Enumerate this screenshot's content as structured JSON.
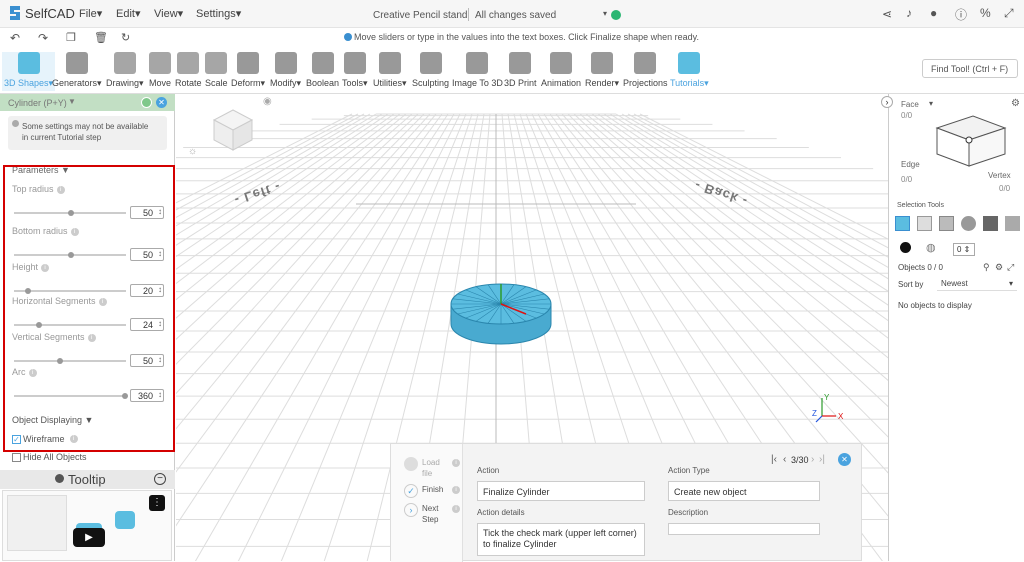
{
  "app": {
    "logo_text": "SelfCAD",
    "menus": [
      "File",
      "Edit",
      "View",
      "Settings"
    ],
    "doc_title": "Creative Pencil stand",
    "save_status": "All changes saved",
    "info_message": "Move sliders or type in the values into the text boxes. Click Finalize shape when ready."
  },
  "toolbar": {
    "tools": [
      "3D Shapes",
      "Generators",
      "Drawing",
      "Move",
      "Rotate",
      "Scale",
      "Deform",
      "Modify",
      "Boolean",
      "Tools",
      "Utilities",
      "Sculpting",
      "Image To 3D",
      "3D Print",
      "Animation",
      "Render",
      "Projections",
      "Tutorials"
    ],
    "search_label": "Find Tool! (Ctrl + F)"
  },
  "panel": {
    "title": "Cylinder (P+Y)",
    "warning": "Some settings may not be available in current Tutorial step",
    "parameters_label": "Parameters",
    "params": [
      {
        "label": "Top radius",
        "value": "50",
        "fraction": 0.5
      },
      {
        "label": "Bottom radius",
        "value": "50",
        "fraction": 0.5
      },
      {
        "label": "Height",
        "value": "20",
        "fraction": 0.1
      },
      {
        "label": "Horizontal Segments",
        "value": "24",
        "fraction": 0.2
      },
      {
        "label": "Vertical Segments",
        "value": "50",
        "fraction": 0.4
      },
      {
        "label": "Arc",
        "value": "360",
        "fraction": 1.0
      }
    ],
    "object_displaying": "Object Displaying",
    "wireframe": "Wireframe",
    "hide_all": "Hide All Objects",
    "tooltip": "Tooltip"
  },
  "viewport": {
    "label_left": "- Left -",
    "label_back": "- Back -",
    "axis_x": "X",
    "axis_y": "Y",
    "axis_z": "Z"
  },
  "right": {
    "face": "Face",
    "face_count": "0/0",
    "edge": "Edge",
    "edge_count": "0/0",
    "vertex": "Vertex",
    "vertex_count": "0/0",
    "selection_tools": "Selection Tools",
    "selection_value": "0",
    "objects": "Objects 0 / 0",
    "sort_by": "Sort by",
    "sort_value": "Newest",
    "no_objects": "No objects to display"
  },
  "tutorial": {
    "steps": [
      "Load file",
      "Finish",
      "Next Step"
    ],
    "counter": "3/30",
    "action_label": "Action",
    "action_value": "Finalize Cylinder",
    "action_details_label": "Action details",
    "action_details": "Tick the check mark (upper left corner) to finalize Cylinder",
    "action_type_label": "Action Type",
    "action_type": "Create new object",
    "description_label": "Description"
  },
  "colors": {
    "accent": "#4aa3df",
    "selected": "#c2dfc4",
    "cylinder": "#5bbde0",
    "highlight": "#d40000"
  }
}
